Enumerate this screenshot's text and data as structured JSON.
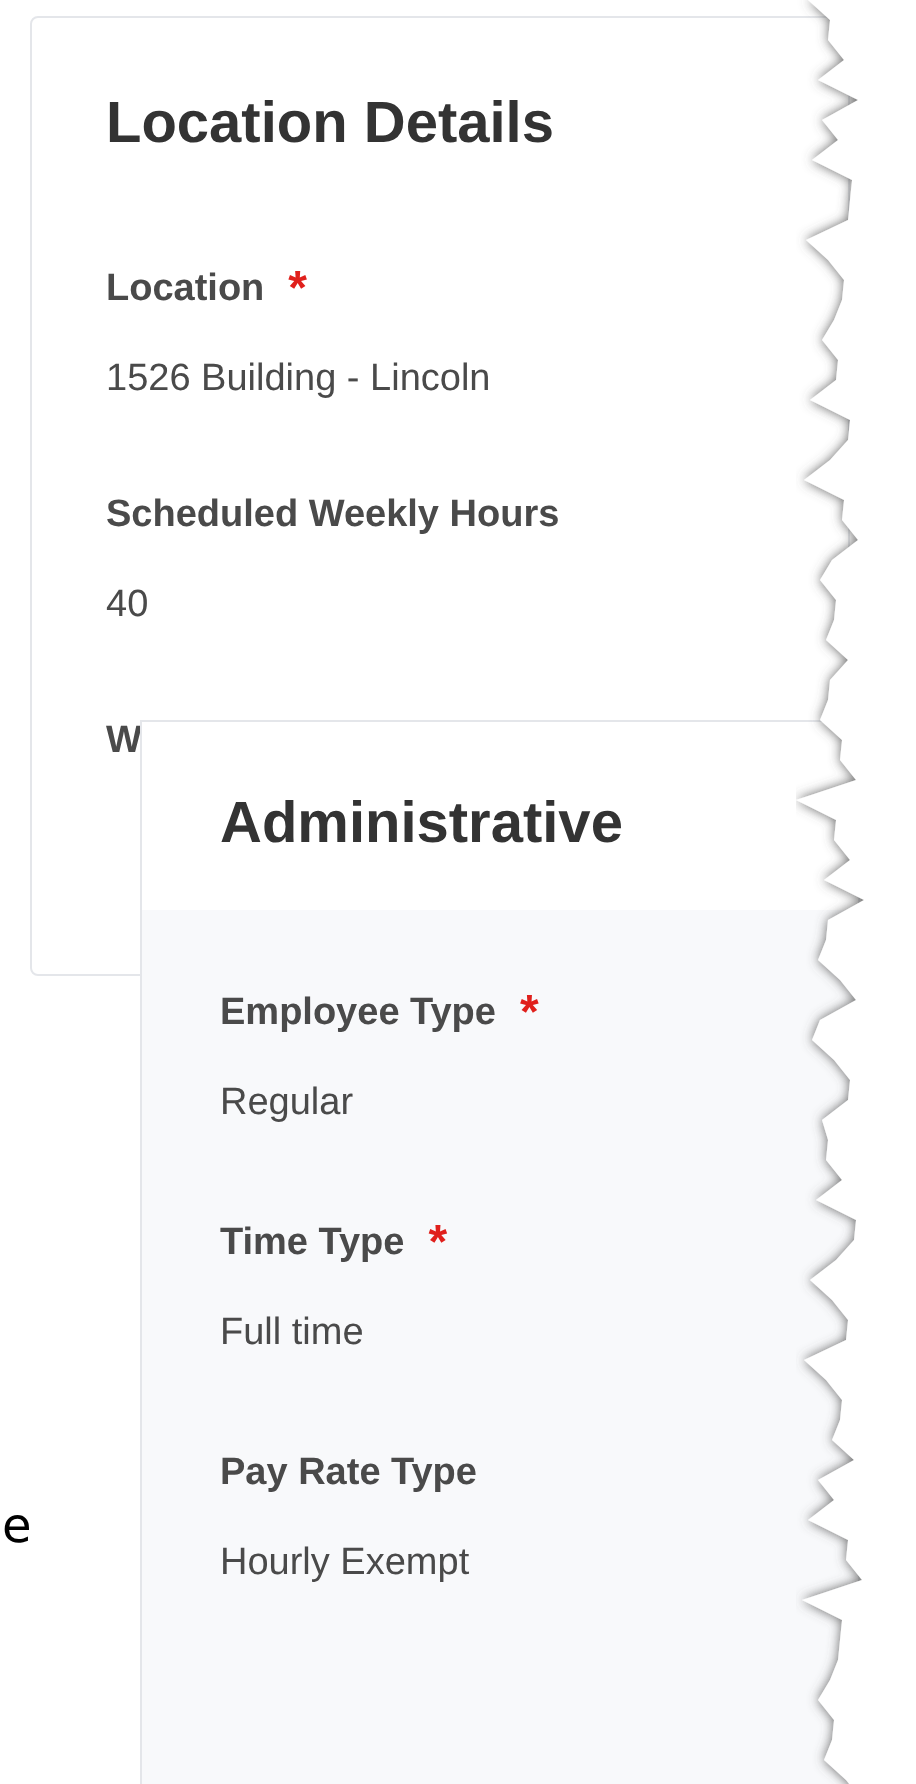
{
  "cards": [
    {
      "title": "Location Details",
      "fields": [
        {
          "label": "Location",
          "required_mark": "*",
          "value": "1526 Building - Lincoln"
        },
        {
          "label": "Scheduled Weekly Hours",
          "value": "40"
        },
        {
          "label": "W"
        }
      ]
    },
    {
      "title": "Administrative",
      "fields": [
        {
          "label": "Employee Type",
          "required_mark": "*",
          "value": "Regular"
        },
        {
          "label": "Time Type",
          "required_mark": "*",
          "value": "Full time"
        },
        {
          "label": "Pay Rate Type",
          "value": "Hourly Exempt"
        }
      ]
    }
  ],
  "stray_text": "e"
}
